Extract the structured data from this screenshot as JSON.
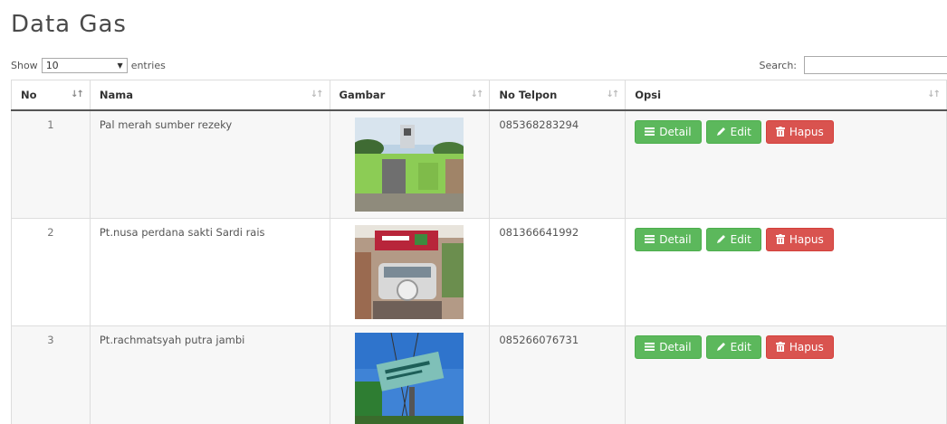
{
  "page": {
    "title": "Data Gas"
  },
  "length": {
    "show_label": "Show",
    "selected": "10",
    "entries_label": "entries"
  },
  "search": {
    "label": "Search:",
    "value": ""
  },
  "table": {
    "columns": [
      "No",
      "Nama",
      "Gambar",
      "No Telpon",
      "Opsi"
    ],
    "rows": [
      {
        "no": "1",
        "nama": "Pal merah sumber rezeky",
        "telp": "085368283294"
      },
      {
        "no": "2",
        "nama": "Pt.nusa perdana sakti Sardi rais",
        "telp": "081366641992"
      },
      {
        "no": "3",
        "nama": "Pt.rachmatsyah putra jambi",
        "telp": "085266076731"
      }
    ]
  },
  "actions": {
    "detail": "Detail",
    "edit": "Edit",
    "hapus": "Hapus"
  },
  "icons": {
    "sort": "sort-icon",
    "detail": "list-icon",
    "edit": "pencil-icon",
    "hapus": "trash-icon"
  },
  "colors": {
    "success": "#5cb85c",
    "danger": "#d9534f"
  }
}
